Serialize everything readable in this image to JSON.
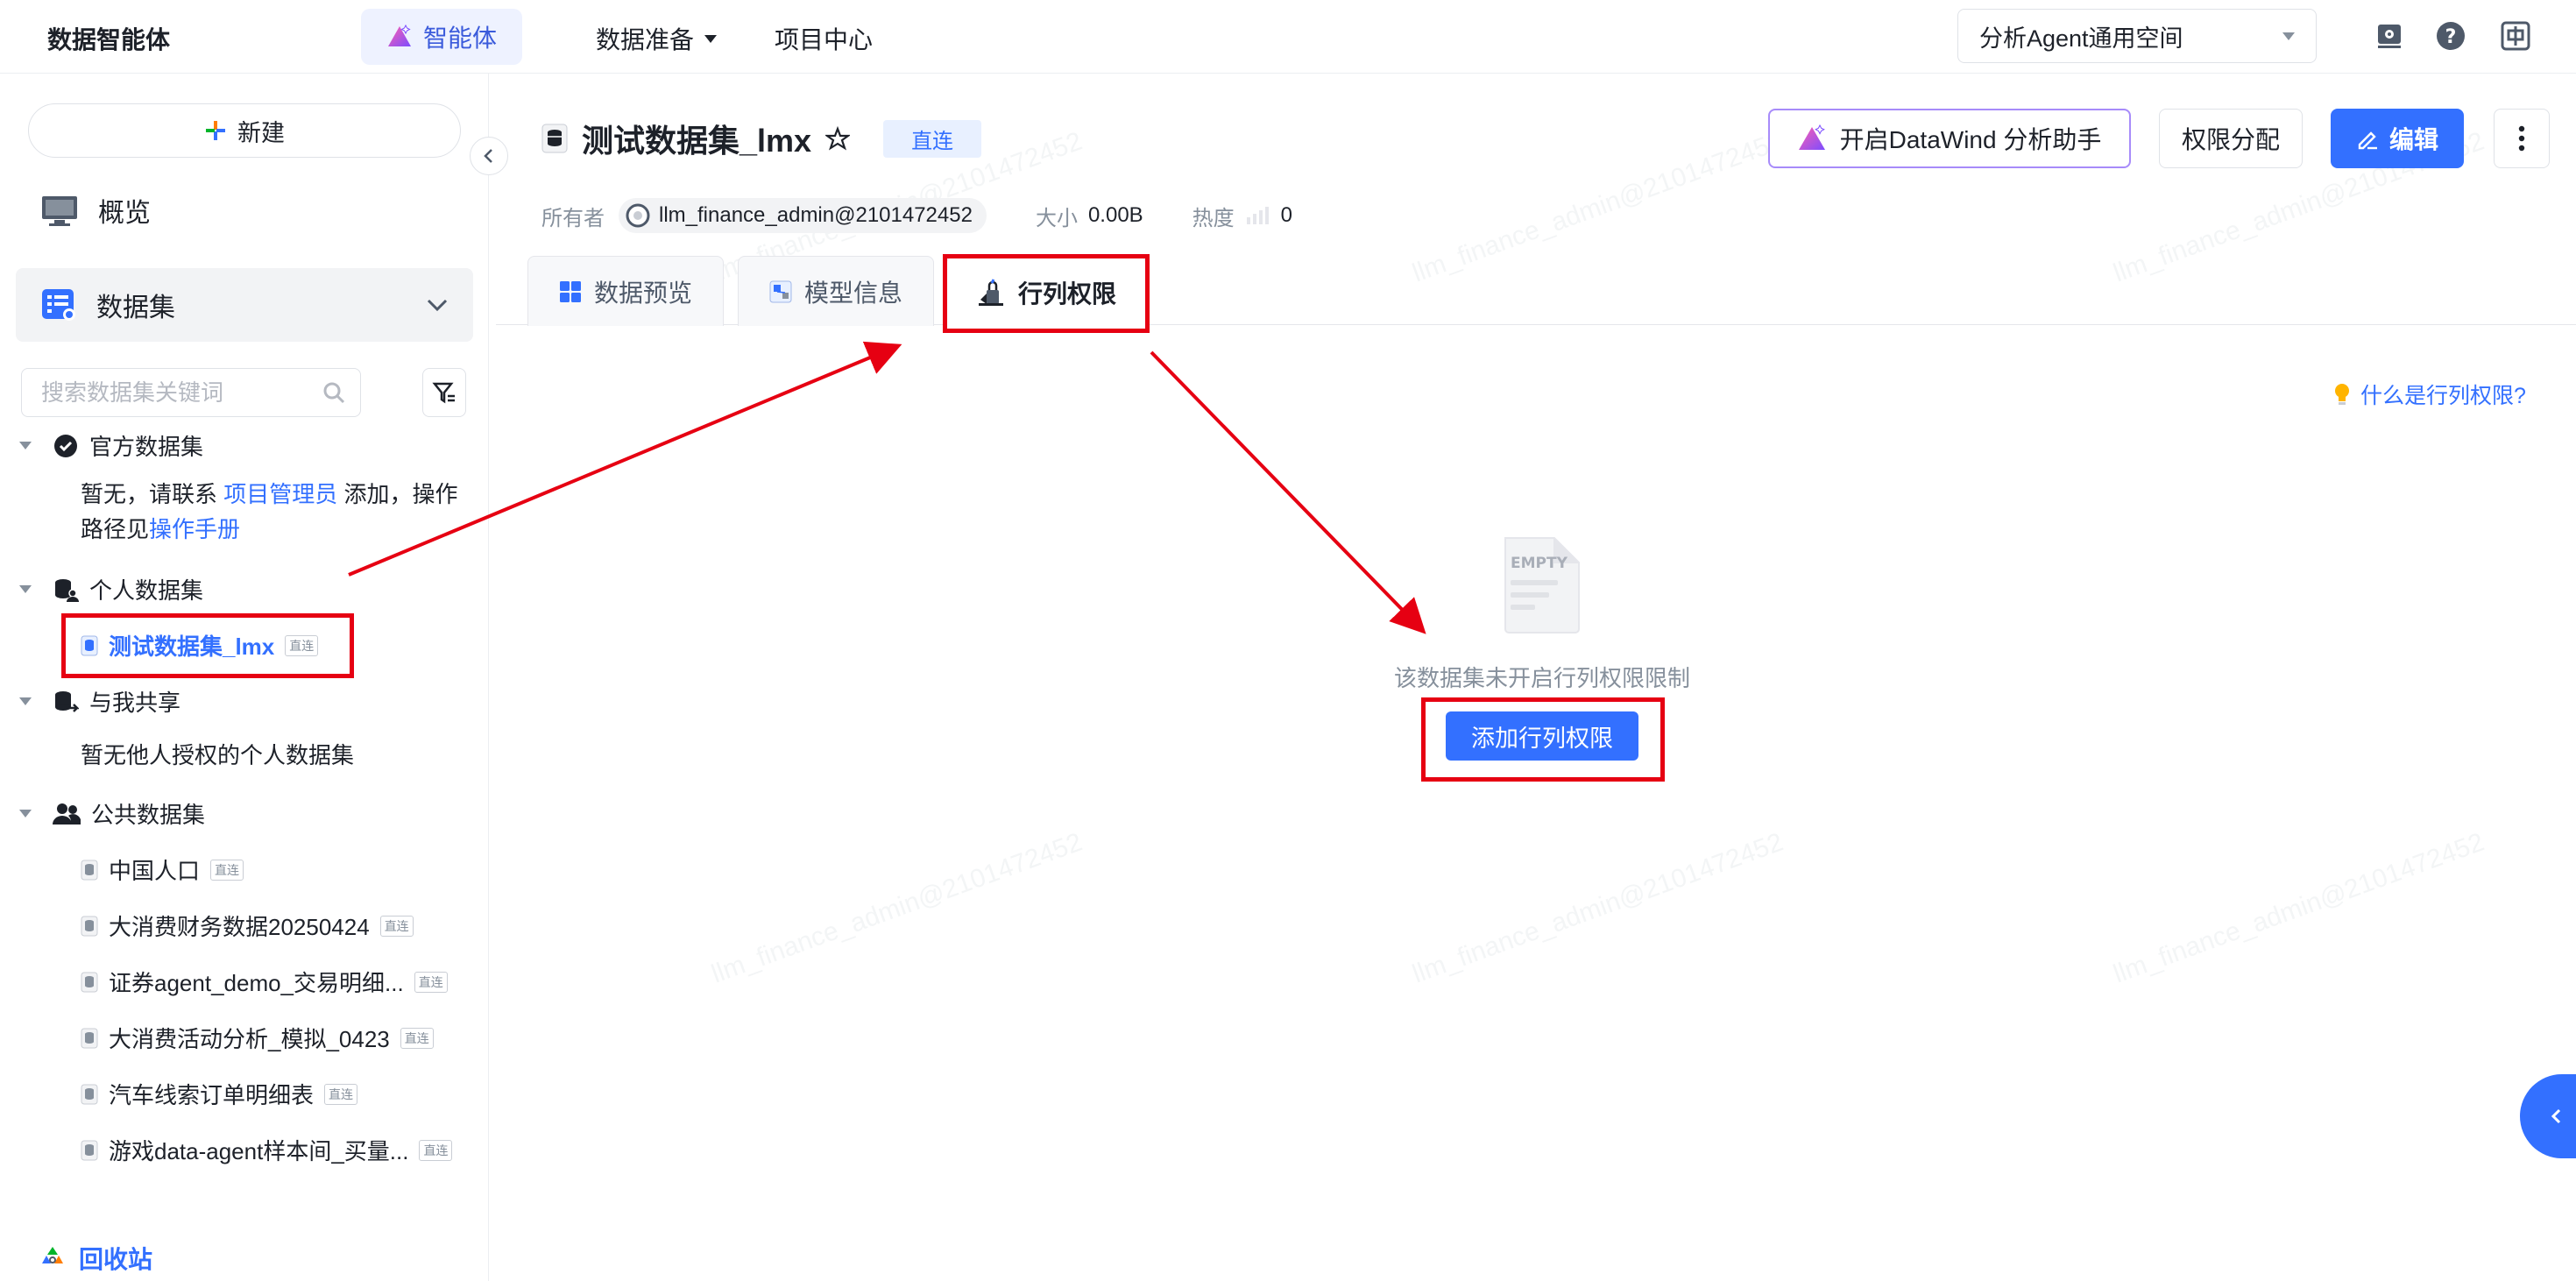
{
  "topnav": {
    "brand": "数据智能体",
    "agent_tab": "智能体",
    "data_prep": "数据准备",
    "project_center": "项目中心",
    "space_selected": "分析Agent通用空间"
  },
  "sidebar": {
    "new_label": "新建",
    "nav": [
      {
        "label": "概览"
      },
      {
        "label": "数据集"
      }
    ],
    "search_placeholder": "搜索数据集关键词",
    "groups": {
      "official": {
        "title": "官方数据集",
        "empty_prefix": "暂无，请联系 ",
        "empty_link1": "项目管理员",
        "empty_middle": " 添加，操作路径见",
        "empty_link2": "操作手册"
      },
      "personal": {
        "title": "个人数据集",
        "items": [
          {
            "name": "测试数据集_lmx",
            "tag": "直连"
          }
        ]
      },
      "shared": {
        "title": "与我共享",
        "empty": "暂无他人授权的个人数据集"
      },
      "public": {
        "title": "公共数据集",
        "items": [
          {
            "name": "中国人口",
            "tag": "直连"
          },
          {
            "name": "大消费财务数据20250424",
            "tag": "直连"
          },
          {
            "name": "证券agent_demo_交易明细...",
            "tag": "直连"
          },
          {
            "name": "大消费活动分析_模拟_0423",
            "tag": "直连"
          },
          {
            "name": "汽车线索订单明细表",
            "tag": "直连"
          },
          {
            "name": "游戏data-agent样本间_买量...",
            "tag": "直连"
          }
        ]
      }
    },
    "recycle": "回收站"
  },
  "main": {
    "title": "测试数据集_lmx",
    "badge": "直连",
    "meta": {
      "owner_label": "所有者",
      "owner": "llm_finance_admin@2101472452",
      "size_label": "大小",
      "size": "0.00B",
      "heat_label": "热度",
      "heat": "0"
    },
    "actions": {
      "assistant": "开启DataWind 分析助手",
      "permission": "权限分配",
      "edit": "编辑"
    },
    "tabs": [
      {
        "label": "数据预览"
      },
      {
        "label": "模型信息"
      },
      {
        "label": "行列权限"
      }
    ],
    "help_link": "什么是行列权限?",
    "empty_illus_text": "EMPTY",
    "empty_msg": "该数据集未开启行列权限限制",
    "add_button": "添加行列权限"
  },
  "watermark": "llm_finance_admin@2101472452",
  "colors": {
    "primary": "#3370ff",
    "annotation_red": "#e60012",
    "accent_purple": "#a78bfa"
  }
}
